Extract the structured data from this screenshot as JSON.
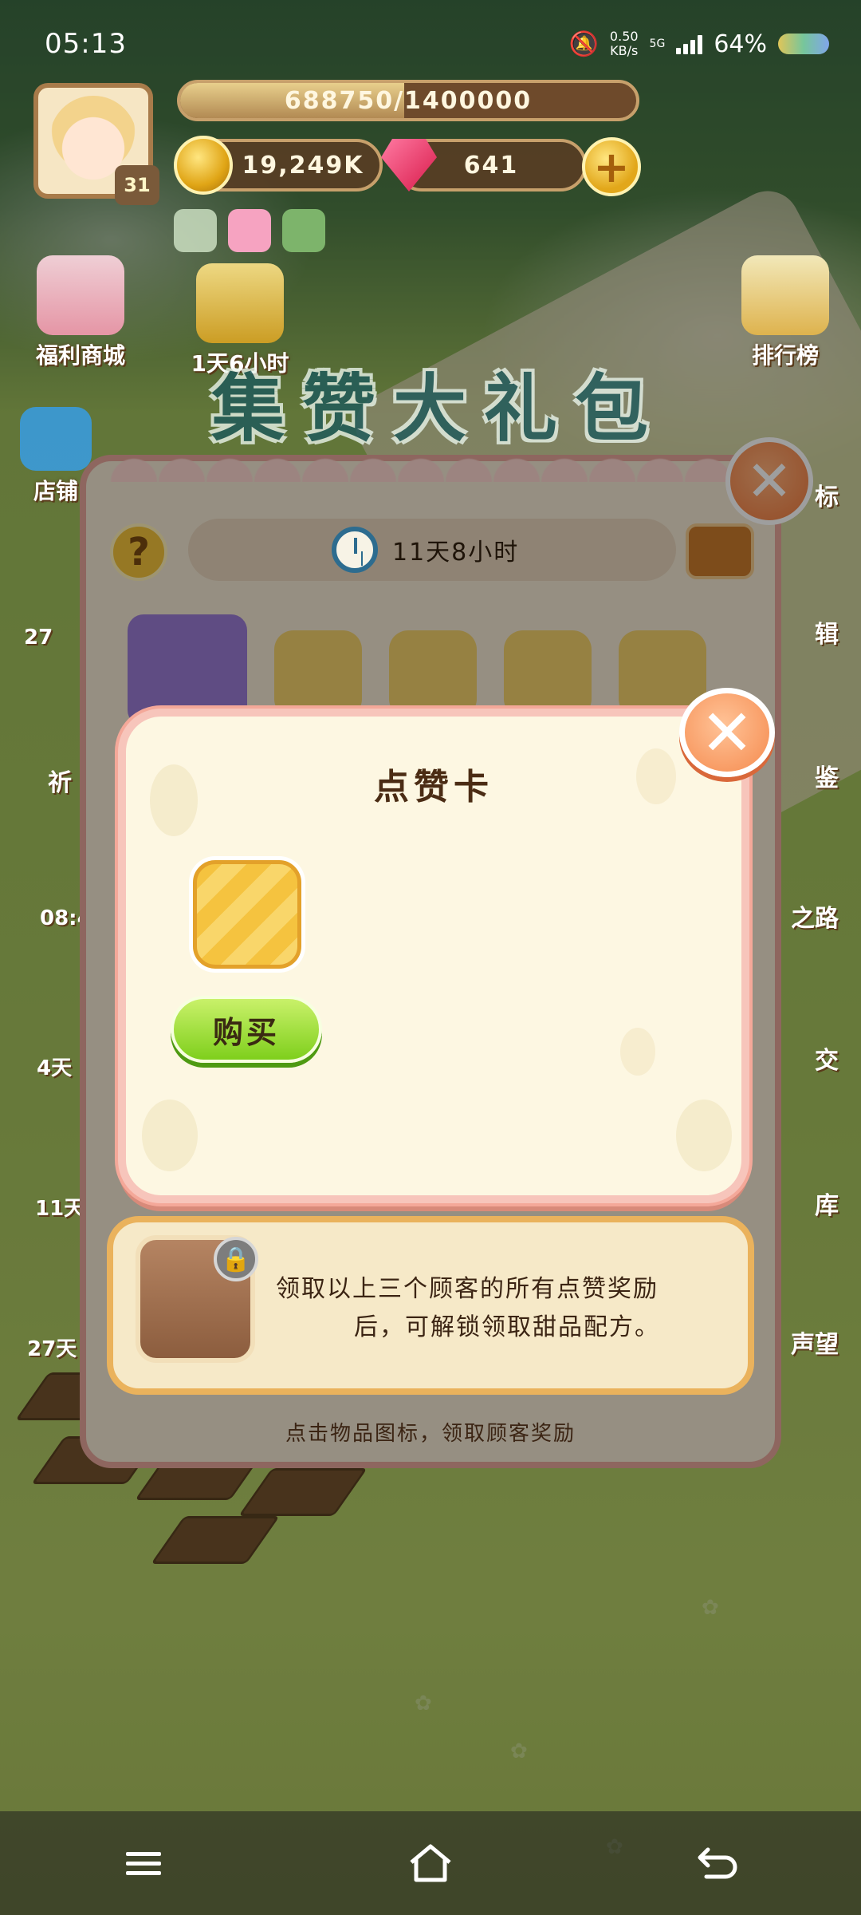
{
  "status_bar": {
    "time": "05:13",
    "net_speed_value": "0.50",
    "net_speed_unit": "KB/s",
    "network": "5G",
    "battery": "64%"
  },
  "hud": {
    "level": "31",
    "xp_text": "688750/1400000",
    "xp_progress": 0.492,
    "coins": "19,249K",
    "gems": "641",
    "plus_label": "+"
  },
  "left_menu": {
    "welfare_shop": "福利商城",
    "timer_1": "1天6小时",
    "shop": "店铺",
    "partial_1": "27",
    "partial_2": "祈",
    "partial_3": "08:4",
    "partial_4": "4天",
    "partial_5": "11天",
    "partial_6": "27天"
  },
  "right_menu": {
    "leaderboard": "排行榜",
    "partial_1": "标",
    "partial_2": "辑",
    "partial_3": "鉴",
    "partial_4": "之路",
    "partial_5": "交",
    "partial_6": "库",
    "partial_7": "声望"
  },
  "gift_panel": {
    "title": "集赞大礼包",
    "help_label": "?",
    "timer": "11天8小时",
    "recipe_text_line1": "领取以上三个顾客的所有点赞奖励",
    "recipe_text_line2": "后，可解锁领取甜品配方。",
    "hint": "点击物品图标，领取顾客奖励"
  },
  "popup": {
    "title": "点赞卡",
    "buy_label": "购买",
    "close_label": "✕"
  },
  "icons": {
    "panel_close": "close-icon",
    "popup_close": "close-icon",
    "lock": "lock-icon",
    "clock": "clock-icon"
  }
}
